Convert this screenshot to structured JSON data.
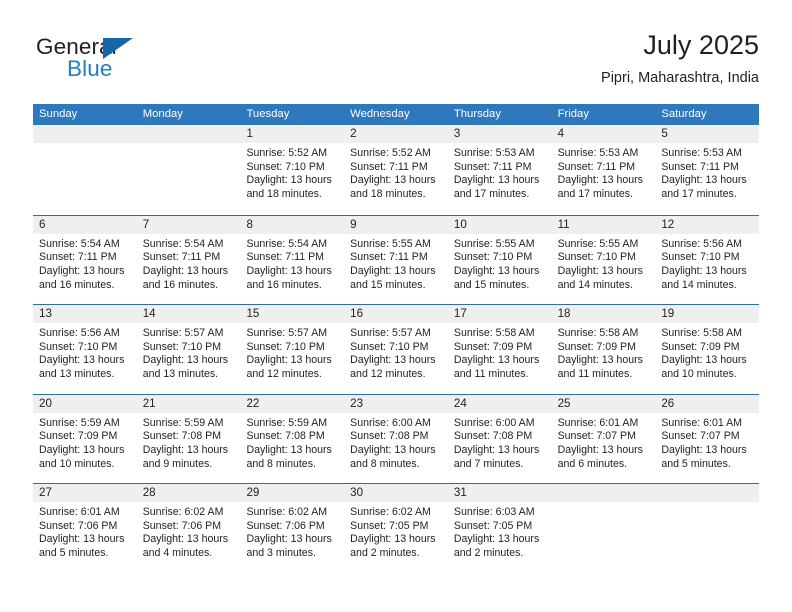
{
  "brand": {
    "word1": "General",
    "word2": "Blue",
    "accent_color": "#1565a8",
    "blue_text_color": "#1f7fc4"
  },
  "header": {
    "title": "July 2025",
    "location": "Pipri, Maharashtra, India"
  },
  "theme": {
    "header_row_bg": "#2e79bd",
    "row_divider": "#2e6ea8",
    "date_band_bg": "#efefef",
    "text": "#231f20"
  },
  "calendar": {
    "day_names": [
      "Sunday",
      "Monday",
      "Tuesday",
      "Wednesday",
      "Thursday",
      "Friday",
      "Saturday"
    ],
    "weeks": [
      [
        {
          "day": "",
          "sunrise": "",
          "sunset": "",
          "daylight": ""
        },
        {
          "day": "",
          "sunrise": "",
          "sunset": "",
          "daylight": ""
        },
        {
          "day": "1",
          "sunrise": "Sunrise: 5:52 AM",
          "sunset": "Sunset: 7:10 PM",
          "daylight": "Daylight: 13 hours and 18 minutes."
        },
        {
          "day": "2",
          "sunrise": "Sunrise: 5:52 AM",
          "sunset": "Sunset: 7:11 PM",
          "daylight": "Daylight: 13 hours and 18 minutes."
        },
        {
          "day": "3",
          "sunrise": "Sunrise: 5:53 AM",
          "sunset": "Sunset: 7:11 PM",
          "daylight": "Daylight: 13 hours and 17 minutes."
        },
        {
          "day": "4",
          "sunrise": "Sunrise: 5:53 AM",
          "sunset": "Sunset: 7:11 PM",
          "daylight": "Daylight: 13 hours and 17 minutes."
        },
        {
          "day": "5",
          "sunrise": "Sunrise: 5:53 AM",
          "sunset": "Sunset: 7:11 PM",
          "daylight": "Daylight: 13 hours and 17 minutes."
        }
      ],
      [
        {
          "day": "6",
          "sunrise": "Sunrise: 5:54 AM",
          "sunset": "Sunset: 7:11 PM",
          "daylight": "Daylight: 13 hours and 16 minutes."
        },
        {
          "day": "7",
          "sunrise": "Sunrise: 5:54 AM",
          "sunset": "Sunset: 7:11 PM",
          "daylight": "Daylight: 13 hours and 16 minutes."
        },
        {
          "day": "8",
          "sunrise": "Sunrise: 5:54 AM",
          "sunset": "Sunset: 7:11 PM",
          "daylight": "Daylight: 13 hours and 16 minutes."
        },
        {
          "day": "9",
          "sunrise": "Sunrise: 5:55 AM",
          "sunset": "Sunset: 7:11 PM",
          "daylight": "Daylight: 13 hours and 15 minutes."
        },
        {
          "day": "10",
          "sunrise": "Sunrise: 5:55 AM",
          "sunset": "Sunset: 7:10 PM",
          "daylight": "Daylight: 13 hours and 15 minutes."
        },
        {
          "day": "11",
          "sunrise": "Sunrise: 5:55 AM",
          "sunset": "Sunset: 7:10 PM",
          "daylight": "Daylight: 13 hours and 14 minutes."
        },
        {
          "day": "12",
          "sunrise": "Sunrise: 5:56 AM",
          "sunset": "Sunset: 7:10 PM",
          "daylight": "Daylight: 13 hours and 14 minutes."
        }
      ],
      [
        {
          "day": "13",
          "sunrise": "Sunrise: 5:56 AM",
          "sunset": "Sunset: 7:10 PM",
          "daylight": "Daylight: 13 hours and 13 minutes."
        },
        {
          "day": "14",
          "sunrise": "Sunrise: 5:57 AM",
          "sunset": "Sunset: 7:10 PM",
          "daylight": "Daylight: 13 hours and 13 minutes."
        },
        {
          "day": "15",
          "sunrise": "Sunrise: 5:57 AM",
          "sunset": "Sunset: 7:10 PM",
          "daylight": "Daylight: 13 hours and 12 minutes."
        },
        {
          "day": "16",
          "sunrise": "Sunrise: 5:57 AM",
          "sunset": "Sunset: 7:10 PM",
          "daylight": "Daylight: 13 hours and 12 minutes."
        },
        {
          "day": "17",
          "sunrise": "Sunrise: 5:58 AM",
          "sunset": "Sunset: 7:09 PM",
          "daylight": "Daylight: 13 hours and 11 minutes."
        },
        {
          "day": "18",
          "sunrise": "Sunrise: 5:58 AM",
          "sunset": "Sunset: 7:09 PM",
          "daylight": "Daylight: 13 hours and 11 minutes."
        },
        {
          "day": "19",
          "sunrise": "Sunrise: 5:58 AM",
          "sunset": "Sunset: 7:09 PM",
          "daylight": "Daylight: 13 hours and 10 minutes."
        }
      ],
      [
        {
          "day": "20",
          "sunrise": "Sunrise: 5:59 AM",
          "sunset": "Sunset: 7:09 PM",
          "daylight": "Daylight: 13 hours and 10 minutes."
        },
        {
          "day": "21",
          "sunrise": "Sunrise: 5:59 AM",
          "sunset": "Sunset: 7:08 PM",
          "daylight": "Daylight: 13 hours and 9 minutes."
        },
        {
          "day": "22",
          "sunrise": "Sunrise: 5:59 AM",
          "sunset": "Sunset: 7:08 PM",
          "daylight": "Daylight: 13 hours and 8 minutes."
        },
        {
          "day": "23",
          "sunrise": "Sunrise: 6:00 AM",
          "sunset": "Sunset: 7:08 PM",
          "daylight": "Daylight: 13 hours and 8 minutes."
        },
        {
          "day": "24",
          "sunrise": "Sunrise: 6:00 AM",
          "sunset": "Sunset: 7:08 PM",
          "daylight": "Daylight: 13 hours and 7 minutes."
        },
        {
          "day": "25",
          "sunrise": "Sunrise: 6:01 AM",
          "sunset": "Sunset: 7:07 PM",
          "daylight": "Daylight: 13 hours and 6 minutes."
        },
        {
          "day": "26",
          "sunrise": "Sunrise: 6:01 AM",
          "sunset": "Sunset: 7:07 PM",
          "daylight": "Daylight: 13 hours and 5 minutes."
        }
      ],
      [
        {
          "day": "27",
          "sunrise": "Sunrise: 6:01 AM",
          "sunset": "Sunset: 7:06 PM",
          "daylight": "Daylight: 13 hours and 5 minutes."
        },
        {
          "day": "28",
          "sunrise": "Sunrise: 6:02 AM",
          "sunset": "Sunset: 7:06 PM",
          "daylight": "Daylight: 13 hours and 4 minutes."
        },
        {
          "day": "29",
          "sunrise": "Sunrise: 6:02 AM",
          "sunset": "Sunset: 7:06 PM",
          "daylight": "Daylight: 13 hours and 3 minutes."
        },
        {
          "day": "30",
          "sunrise": "Sunrise: 6:02 AM",
          "sunset": "Sunset: 7:05 PM",
          "daylight": "Daylight: 13 hours and 2 minutes."
        },
        {
          "day": "31",
          "sunrise": "Sunrise: 6:03 AM",
          "sunset": "Sunset: 7:05 PM",
          "daylight": "Daylight: 13 hours and 2 minutes."
        },
        {
          "day": "",
          "sunrise": "",
          "sunset": "",
          "daylight": ""
        },
        {
          "day": "",
          "sunrise": "",
          "sunset": "",
          "daylight": ""
        }
      ]
    ]
  }
}
